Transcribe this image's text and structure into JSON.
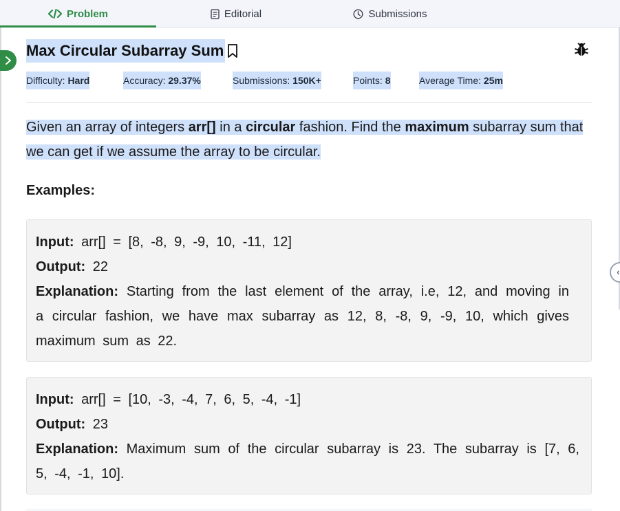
{
  "tabs": [
    {
      "label": "Problem",
      "icon": "code-icon"
    },
    {
      "label": "Editorial",
      "icon": "document-icon"
    },
    {
      "label": "Submissions",
      "icon": "clock-icon"
    }
  ],
  "problem": {
    "title": "Max Circular Subarray Sum",
    "meta": {
      "difficulty_label": "Difficulty: ",
      "difficulty": "Hard",
      "accuracy_label": "Accuracy: ",
      "accuracy": "29.37%",
      "submissions_label": "Submissions: ",
      "submissions": "150K+",
      "points_label": "Points: ",
      "points": "8",
      "avg_time_label": "Average Time: ",
      "avg_time": "25m"
    },
    "description": {
      "p1": "Given an array of integers ",
      "b1": "arr[]",
      "p2": " in a ",
      "b2": "circular",
      "p3": " fashion. Find the ",
      "b3": "maximum",
      "p4": " subarray sum that we can get if we assume the array to be circular."
    }
  },
  "examples_heading": "Examples:",
  "examples": [
    {
      "input_label": "Input:",
      "input": " arr[] = [8, -8, 9, -9, 10, -11, 12]",
      "output_label": "Output:",
      "output": " 22",
      "explanation_label": "Explanation:",
      "explanation": " Starting from the last element of the array, i.e, 12, and moving in a circular fashion, we have max subarray as 12, 8, -8, 9, -9, 10, which gives maximum sum as 22."
    },
    {
      "input_label": "Input:",
      "input": " arr[] = [10, -3, -4, 7, 6, 5, -4, -1]",
      "output_label": "Output:",
      "output": " 23",
      "explanation_label": "Explanation:",
      "explanation": " Maximum sum of the circular subarray is 23. The subarray is [7, 6, 5, -4, -1, 10]."
    }
  ],
  "colors": {
    "accent": "#2f8d46",
    "highlight": "#cfe0fb",
    "example_bg": "#f3f3f3"
  }
}
